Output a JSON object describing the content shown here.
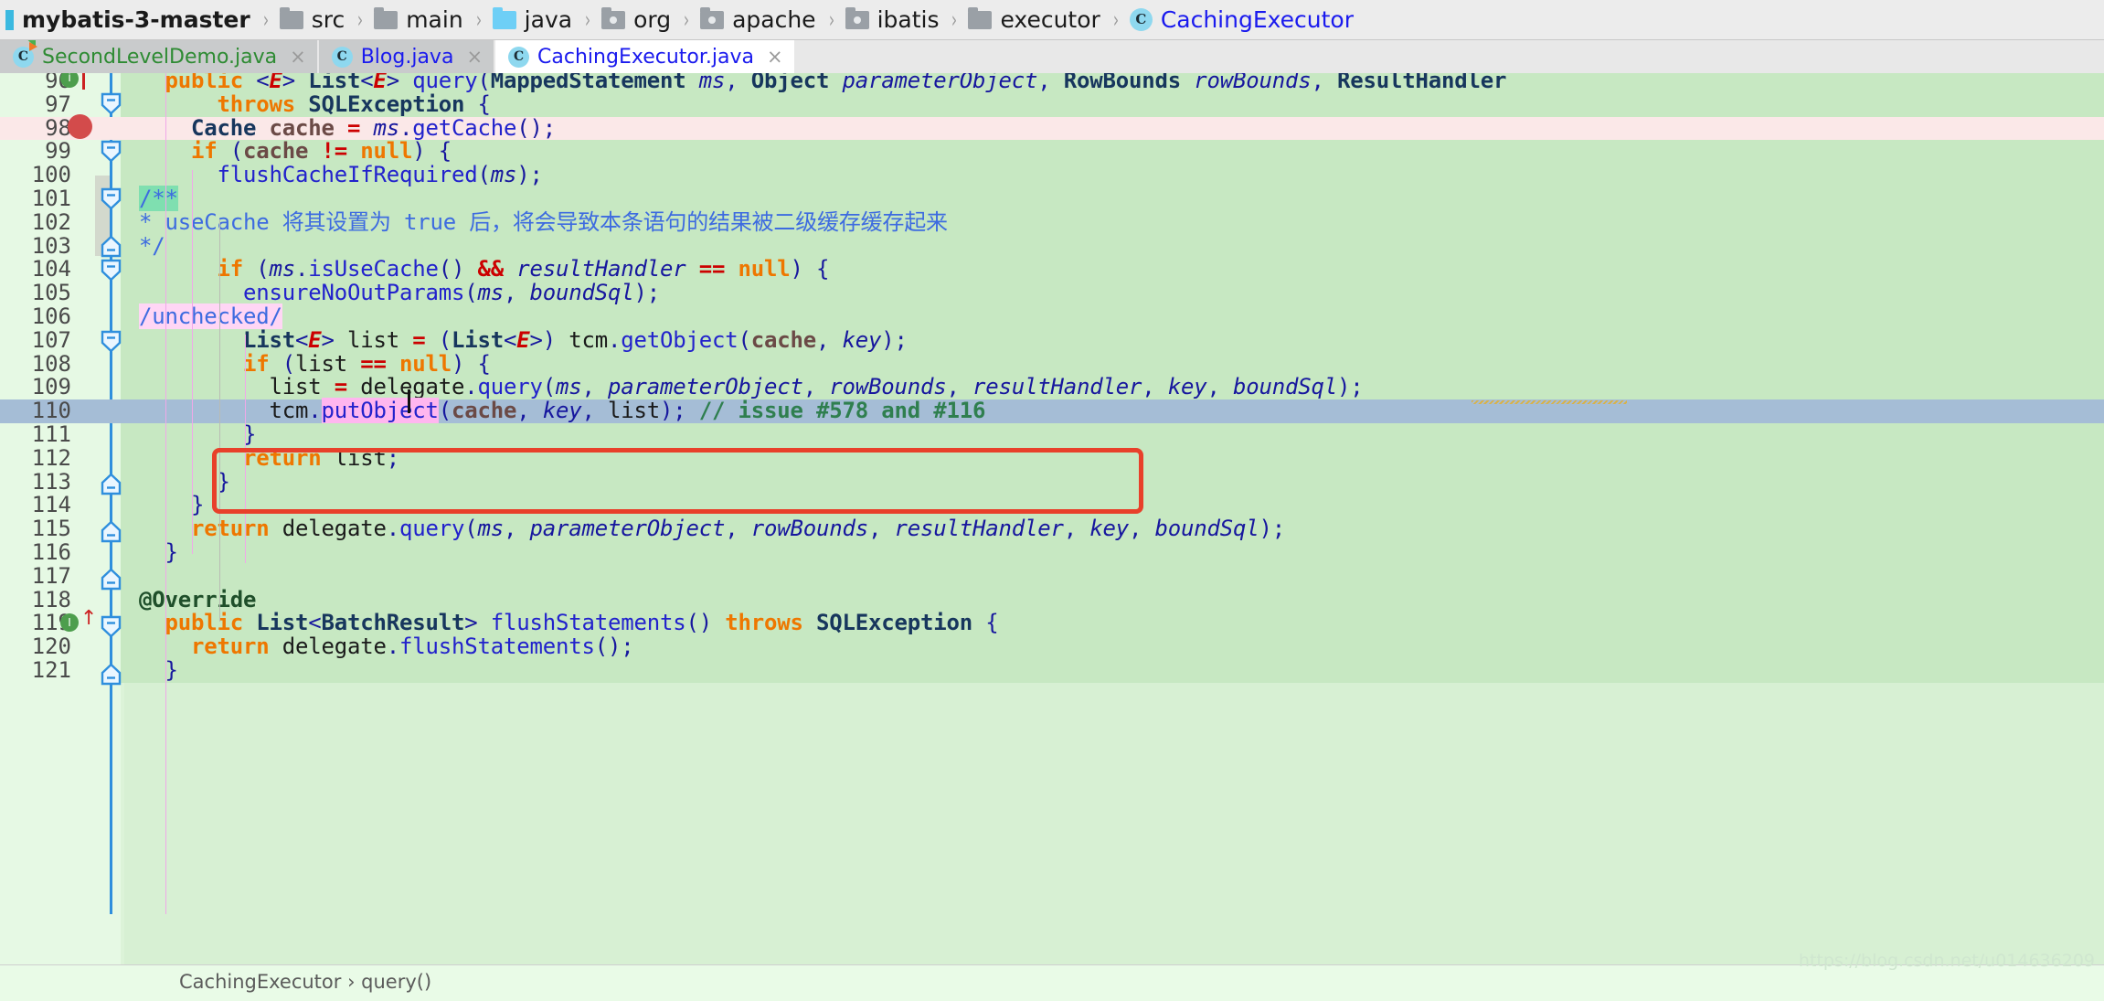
{
  "breadcrumb": {
    "items": [
      {
        "label": "mybatis-3-master",
        "icon": "module-icon",
        "kind": "root"
      },
      {
        "label": "src",
        "icon": "folder-icon",
        "kind": "folder"
      },
      {
        "label": "main",
        "icon": "folder-icon",
        "kind": "folder"
      },
      {
        "label": "java",
        "icon": "source-folder-icon",
        "kind": "source"
      },
      {
        "label": "org",
        "icon": "package-icon",
        "kind": "package"
      },
      {
        "label": "apache",
        "icon": "package-icon",
        "kind": "package"
      },
      {
        "label": "ibatis",
        "icon": "package-icon",
        "kind": "package"
      },
      {
        "label": "executor",
        "icon": "folder-icon",
        "kind": "folder"
      },
      {
        "label": "CachingExecutor",
        "icon": "class-icon",
        "kind": "class"
      }
    ],
    "separator": "›"
  },
  "tabs": [
    {
      "label": "SecondLevelDemo.java",
      "icon": "runnable-class-icon",
      "close": "×",
      "active": false,
      "color": "green"
    },
    {
      "label": "Blog.java",
      "icon": "class-icon",
      "close": "×",
      "active": false,
      "color": "blue"
    },
    {
      "label": "CachingExecutor.java",
      "icon": "class-icon",
      "close": "×",
      "active": true,
      "color": "blue"
    }
  ],
  "editor": {
    "first_visible_line": 96,
    "current_line": 110,
    "breakpoint_line": 98,
    "caret": {
      "line": 110,
      "column_label": "putObject"
    },
    "lines": [
      {
        "n": 96,
        "text": "  public <E> List<E> query(MappedStatement ms, Object parameterObject, RowBounds rowBounds, ResultHandler"
      },
      {
        "n": 97,
        "text": "      throws SQLException {"
      },
      {
        "n": 98,
        "text": "    Cache cache = ms.getCache();"
      },
      {
        "n": 99,
        "text": "    if (cache != null) {"
      },
      {
        "n": 100,
        "text": "      flushCacheIfRequired(ms);"
      },
      {
        "n": 101,
        "text": "      /**"
      },
      {
        "n": 102,
        "text": "       * useCache 将其设置为 true 后，将会导致本条语句的结果被二级缓存缓存起来"
      },
      {
        "n": 103,
        "text": "       */"
      },
      {
        "n": 104,
        "text": "      if (ms.isUseCache() && resultHandler == null) {"
      },
      {
        "n": 105,
        "text": "        ensureNoOutParams(ms, boundSql);"
      },
      {
        "n": 106,
        "text": "        /unchecked/"
      },
      {
        "n": 107,
        "text": "        List<E> list = (List<E>) tcm.getObject(cache, key);"
      },
      {
        "n": 108,
        "text": "        if (list == null) {"
      },
      {
        "n": 109,
        "text": "          list = delegate.query(ms, parameterObject, rowBounds, resultHandler, key, boundSql);"
      },
      {
        "n": 110,
        "text": "          tcm.putObject(cache, key, list); // issue #578 and #116"
      },
      {
        "n": 111,
        "text": "        }"
      },
      {
        "n": 112,
        "text": "        return list;"
      },
      {
        "n": 113,
        "text": "      }"
      },
      {
        "n": 114,
        "text": "    }"
      },
      {
        "n": 115,
        "text": "    return delegate.query(ms, parameterObject, rowBounds, resultHandler, key, boundSql);"
      },
      {
        "n": 116,
        "text": "  }"
      },
      {
        "n": 117,
        "text": ""
      },
      {
        "n": 118,
        "text": "  @Override"
      },
      {
        "n": 119,
        "text": "  public List<BatchResult> flushStatements() throws SQLException {"
      },
      {
        "n": 120,
        "text": "    return delegate.flushStatements();"
      },
      {
        "n": 121,
        "text": "  }"
      }
    ],
    "highlights": {
      "javadoc_open": "/**",
      "unchecked": "/unchecked/",
      "caret_word": "putObject",
      "line_comment": "// issue #578 and #116"
    },
    "annotation_box": {
      "shape": "rounded-rectangle",
      "color": "#e8402a",
      "covers_lines": "109-111"
    }
  },
  "bottom": {
    "breadcrumb": "CachingExecutor › query()",
    "watermark": "https://blog.csdn.net/u014636209"
  },
  "colors": {
    "editor_bg": "#c7e8c2",
    "gutter_bg": "#e6f9e4",
    "current_line": "#a5bdd6",
    "breakpoint_line": "#fbe8e8",
    "breakpoint_dot": "#d34b4b",
    "annotation_box": "#e8402a",
    "keyword": "#ee7700",
    "comment_javadoc": "#3d6be0",
    "comment_line": "#2f7f4f",
    "operator": "#cc0000",
    "highlight_pink": "#ffb6ef",
    "highlight_green": "#7fdfb0",
    "tab_active_bg": "#ffffff",
    "tab_inactive_bg": "#c9cbcc"
  }
}
